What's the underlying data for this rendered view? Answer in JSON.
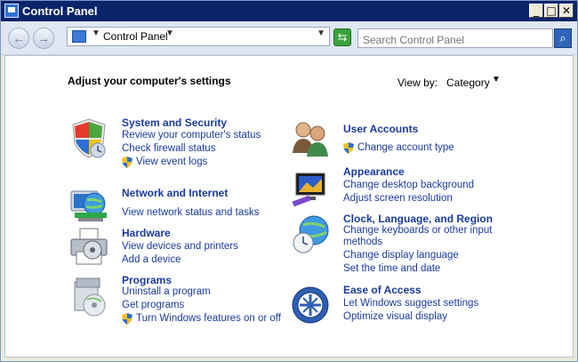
{
  "window": {
    "title": "Control Panel"
  },
  "titlebar_buttons": {
    "minimize": "_",
    "maximize": "□",
    "close": "✕"
  },
  "address": {
    "label": "Control Panel"
  },
  "search": {
    "placeholder": "Search Control Panel"
  },
  "content": {
    "heading": "Adjust your computer's settings",
    "view_by_label": "View by:",
    "view_by_value": "Category"
  },
  "categories": {
    "system_security": {
      "title": "System and Security",
      "links": [
        "Review your computer's status",
        "Check firewall status",
        "View event logs"
      ]
    },
    "network": {
      "title": "Network and Internet",
      "links": [
        "View network status and tasks"
      ]
    },
    "hardware": {
      "title": "Hardware",
      "links": [
        "View devices and printers",
        "Add a device"
      ]
    },
    "programs": {
      "title": "Programs",
      "links": [
        "Uninstall a program",
        "Get programs",
        "Turn Windows features on or off"
      ]
    },
    "user_accounts": {
      "title": "User Accounts",
      "links": [
        "Change account type"
      ]
    },
    "appearance": {
      "title": "Appearance",
      "links": [
        "Change desktop background",
        "Adjust screen resolution"
      ]
    },
    "clock": {
      "title": "Clock, Language, and Region",
      "links": [
        "Change keyboards or other input",
        "methods",
        "Change display language",
        "Set the time and date"
      ]
    },
    "ease": {
      "title": "Ease of Access",
      "links": [
        "Let Windows suggest settings",
        "Optimize visual display"
      ]
    }
  }
}
